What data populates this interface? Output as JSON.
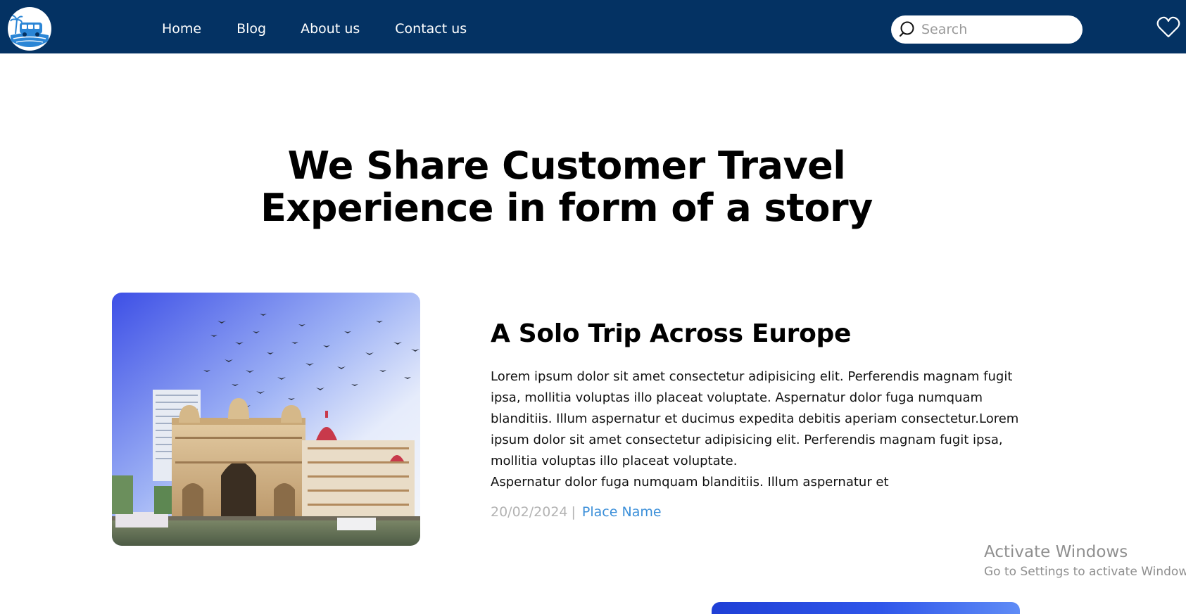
{
  "nav": {
    "links": [
      "Home",
      "Blog",
      "About us",
      "Contact us"
    ],
    "search_placeholder": "Search",
    "logo_icon": "travel-van-palm-logo",
    "favorites_icon": "heart-icon"
  },
  "hero": {
    "title_line1": "We Share Customer Travel",
    "title_line2": "Experience in form of a story"
  },
  "story": {
    "title": "A Solo Trip Across Europe",
    "body_line1": "Lorem ipsum dolor sit amet consectetur adipisicing elit. Perferendis magnam fugit ipsa, mollitia voluptas illo placeat voluptate. Aspernatur dolor fuga numquam blanditiis. Illum aspernatur et ducimus expedita debitis aperiam consectetur.Lorem ipsum dolor sit amet consectetur adipisicing elit. Perferendis magnam fugit ipsa, mollitia voluptas illo placeat voluptate.",
    "body_line2": "Aspernatur dolor fuga numquam blanditiis. Illum aspernatur et",
    "date": "20/02/2024",
    "separator": "|",
    "place": "Place Name",
    "image_subject": "gateway-of-india-photo"
  },
  "watermark": {
    "title": "Activate Windows",
    "subtitle": "Go to Settings to activate Windows."
  },
  "colors": {
    "navbar": "#043263",
    "link_accent": "#3b8fd9",
    "date_gray": "#b3b3b3"
  }
}
